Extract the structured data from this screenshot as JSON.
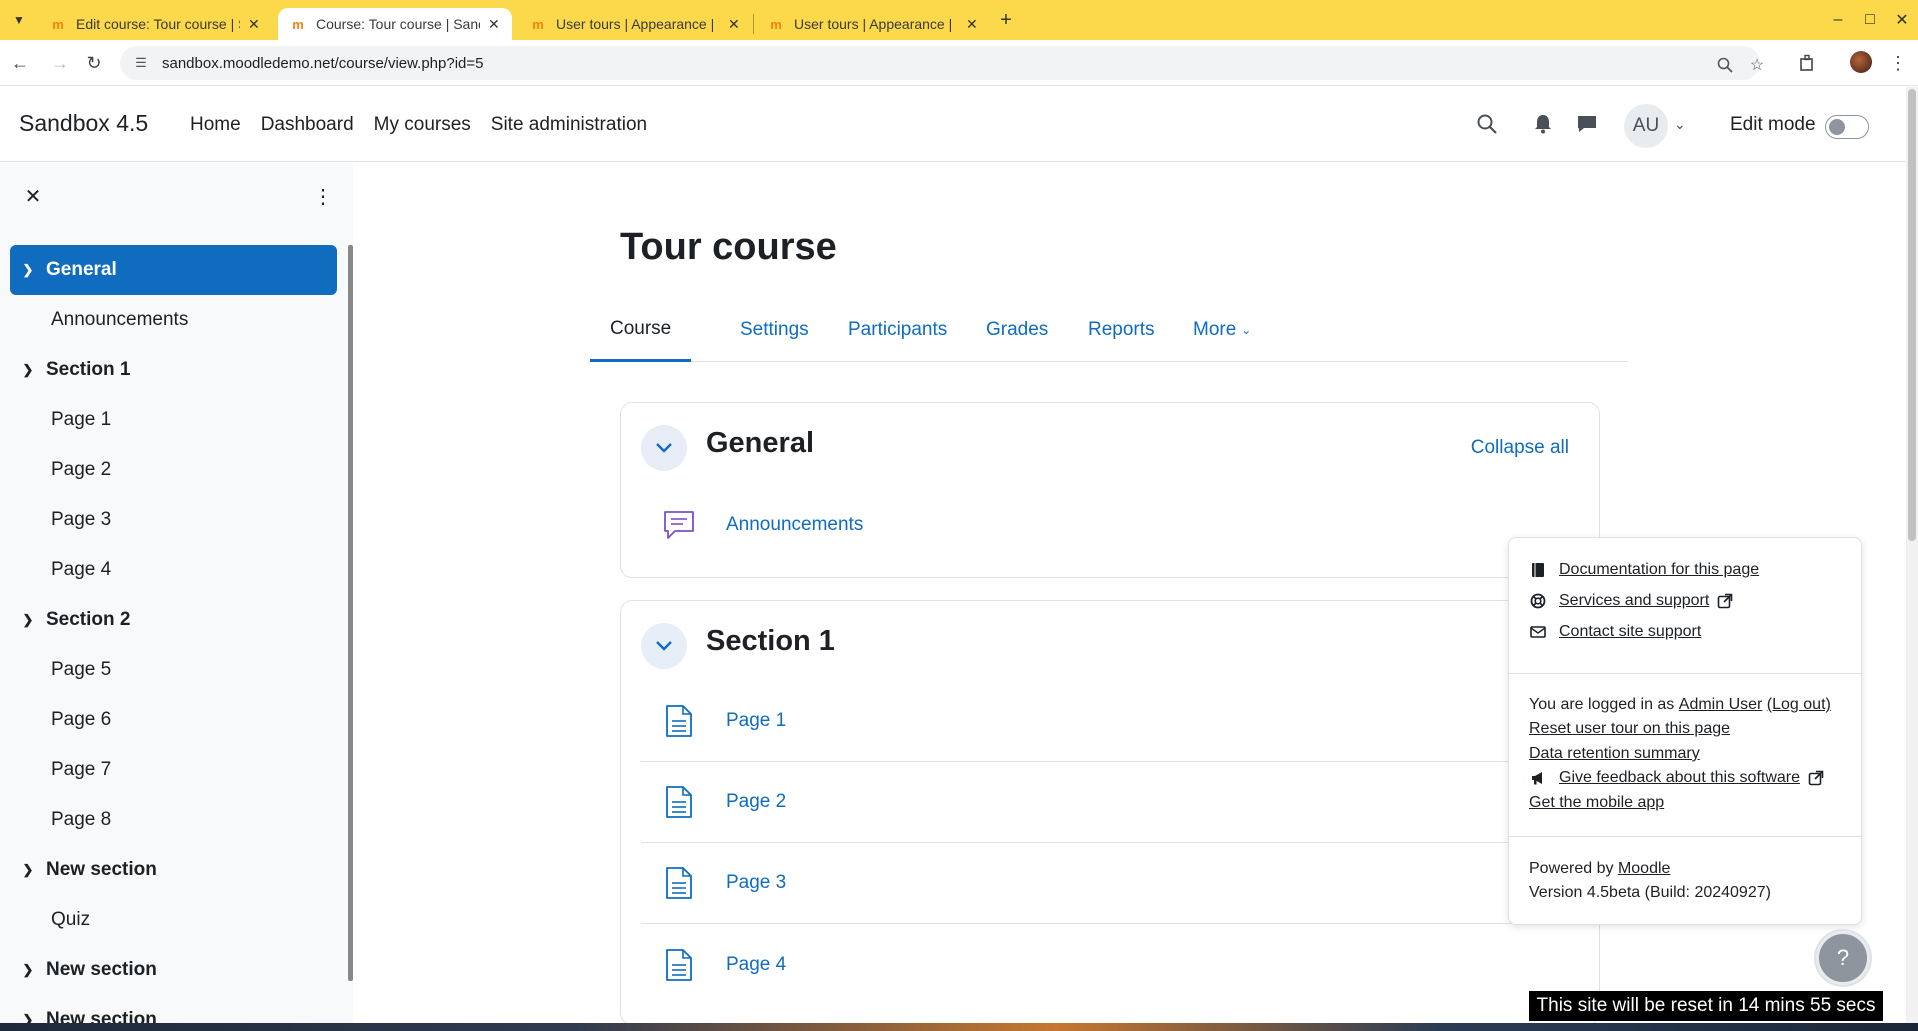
{
  "browser": {
    "tabs": [
      {
        "title": "Edit course: Tour course | S",
        "active": false
      },
      {
        "title": "Course: Tour course | Sand",
        "active": true
      },
      {
        "title": "User tours | Appearance |",
        "active": false
      },
      {
        "title": "User tours | Appearance |",
        "active": false
      }
    ],
    "url": "sandbox.moodledemo.net/course/view.php?id=5"
  },
  "navbar": {
    "brand": "Sandbox 4.5",
    "links": [
      "Home",
      "Dashboard",
      "My courses",
      "Site administration"
    ],
    "avatar_initials": "AU",
    "edit_mode_label": "Edit mode"
  },
  "course_index": {
    "items": [
      {
        "label": "General",
        "type": "section",
        "active": true
      },
      {
        "label": "Announcements",
        "type": "activity"
      },
      {
        "label": "Section 1",
        "type": "section"
      },
      {
        "label": "Page 1",
        "type": "activity"
      },
      {
        "label": "Page 2",
        "type": "activity"
      },
      {
        "label": "Page 3",
        "type": "activity"
      },
      {
        "label": "Page 4",
        "type": "activity"
      },
      {
        "label": "Section 2",
        "type": "section"
      },
      {
        "label": "Page 5",
        "type": "activity"
      },
      {
        "label": "Page 6",
        "type": "activity"
      },
      {
        "label": "Page 7",
        "type": "activity"
      },
      {
        "label": "Page 8",
        "type": "activity"
      },
      {
        "label": "New section",
        "type": "section"
      },
      {
        "label": "Quiz",
        "type": "activity"
      },
      {
        "label": "New section",
        "type": "section"
      },
      {
        "label": "New section",
        "type": "section"
      }
    ]
  },
  "course": {
    "title": "Tour course",
    "tabs": [
      "Course",
      "Settings",
      "Participants",
      "Grades",
      "Reports",
      "More"
    ],
    "collapse_all": "Collapse all",
    "sections": [
      {
        "title": "General",
        "activities": [
          "Announcements"
        ]
      },
      {
        "title": "Section 1",
        "activities": [
          "Page 1",
          "Page 2",
          "Page 3",
          "Page 4"
        ]
      }
    ]
  },
  "footer_popover": {
    "documentation": "Documentation for this page",
    "services": "Services and support",
    "contact": "Contact site support",
    "logged_in_prefix": "You are logged in as",
    "user_name": "Admin User",
    "logout": "(Log out)",
    "reset_tour": "Reset user tour on this page",
    "data_retention": "Data retention summary",
    "feedback": "Give feedback about this software",
    "mobile_app": "Get the mobile app",
    "powered_by": "Powered by",
    "moodle": "Moodle",
    "version": "Version 4.5beta (Build: 20240927)"
  },
  "help_button": "?",
  "reset_banner": "This site will be reset in 14 mins 55 secs",
  "colors": {
    "primary": "#0f6cbf",
    "tabbar": "#fcd84b"
  }
}
